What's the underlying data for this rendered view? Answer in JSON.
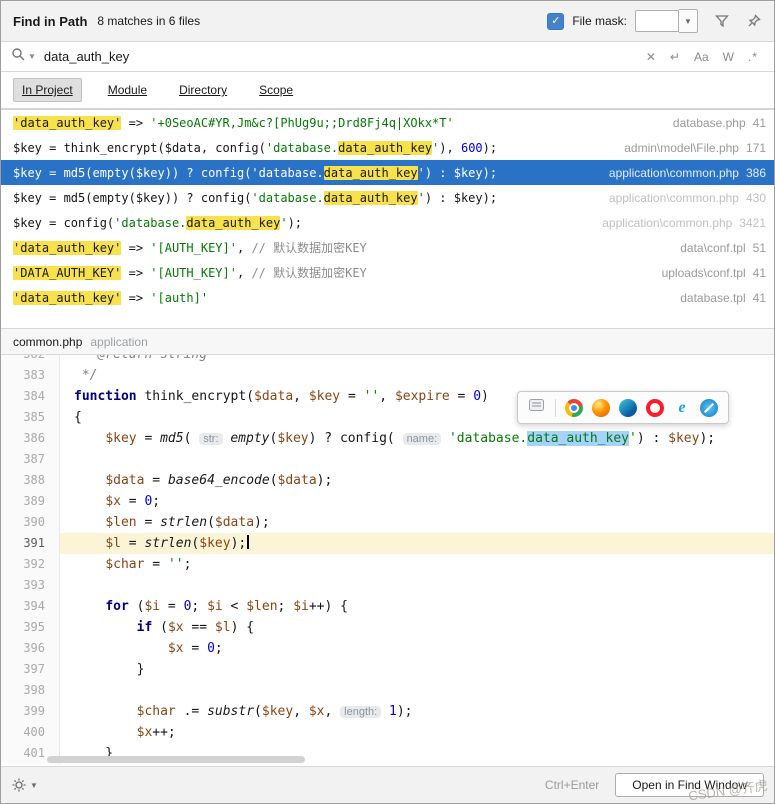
{
  "header": {
    "title": "Find in Path",
    "summary": "8 matches in 6 files",
    "file_mask_label": "File mask:",
    "file_mask_checked": true,
    "file_mask_value": ""
  },
  "search": {
    "query": "data_auth_key",
    "match_case_label": "Aa",
    "whole_words_label": "W",
    "regex_label": ".*"
  },
  "tabs": [
    {
      "label": "In Project",
      "active": true
    },
    {
      "label": "Module",
      "active": false
    },
    {
      "label": "Directory",
      "active": false
    },
    {
      "label": "Scope",
      "active": false
    }
  ],
  "results": [
    {
      "selected": false,
      "dim": false,
      "path": "database.php",
      "line": "41",
      "segments": [
        {
          "t": "'data_auth_key'",
          "c": "str match"
        },
        {
          "t": " => ",
          "c": "pl"
        },
        {
          "t": "'+0SeoAC#YR,Jm&c?[PhUg9u;;Drd8Fj4q|XOkx*T'",
          "c": "str"
        }
      ]
    },
    {
      "selected": false,
      "dim": false,
      "path": "admin\\model\\File.php",
      "line": "171",
      "segments": [
        {
          "t": "$key = think_encrypt($data, config(",
          "c": "pl"
        },
        {
          "t": "'database.",
          "c": "str"
        },
        {
          "t": "data_auth_key",
          "c": "str match"
        },
        {
          "t": "'",
          "c": "str"
        },
        {
          "t": "), ",
          "c": "pl"
        },
        {
          "t": "600",
          "c": "num"
        },
        {
          "t": ");",
          "c": "pl"
        }
      ]
    },
    {
      "selected": true,
      "dim": false,
      "path": "application\\common.php",
      "line": "386",
      "segments": [
        {
          "t": "$key = md5(empty($key)) ? config('database.",
          "c": "pl"
        },
        {
          "t": "data_auth_key",
          "c": "match"
        },
        {
          "t": "') : $key);",
          "c": "pl"
        }
      ]
    },
    {
      "selected": false,
      "dim": true,
      "path": "application\\common.php",
      "line": "430",
      "segments": [
        {
          "t": "$key = md5(empty($key)) ? config(",
          "c": "pl"
        },
        {
          "t": "'database.",
          "c": "str"
        },
        {
          "t": "data_auth_key",
          "c": "str match"
        },
        {
          "t": "'",
          "c": "str"
        },
        {
          "t": ") : $key);",
          "c": "pl"
        }
      ]
    },
    {
      "selected": false,
      "dim": true,
      "path": "application\\common.php",
      "line": "3421",
      "segments": [
        {
          "t": "$key = config(",
          "c": "pl"
        },
        {
          "t": "'database.",
          "c": "str"
        },
        {
          "t": "data_auth_key",
          "c": "str match"
        },
        {
          "t": "'",
          "c": "str"
        },
        {
          "t": ");",
          "c": "pl"
        }
      ]
    },
    {
      "selected": false,
      "dim": false,
      "path": "data\\conf.tpl",
      "line": "51",
      "segments": [
        {
          "t": "'data_auth_key'",
          "c": "str match"
        },
        {
          "t": " => ",
          "c": "pl"
        },
        {
          "t": "'[AUTH_KEY]'",
          "c": "str"
        },
        {
          "t": ", ",
          "c": "pl"
        },
        {
          "t": "// 默认数据加密KEY",
          "c": "cmt"
        }
      ]
    },
    {
      "selected": false,
      "dim": false,
      "path": "uploads\\conf.tpl",
      "line": "41",
      "segments": [
        {
          "t": "'DATA_AUTH_KEY'",
          "c": "str match"
        },
        {
          "t": " => ",
          "c": "pl"
        },
        {
          "t": "'[AUTH_KEY]'",
          "c": "str"
        },
        {
          "t": ", ",
          "c": "pl"
        },
        {
          "t": "// 默认数据加密KEY",
          "c": "cmt"
        }
      ]
    },
    {
      "selected": false,
      "dim": false,
      "path": "database.tpl",
      "line": "41",
      "segments": [
        {
          "t": "'data_auth_key'",
          "c": "str match"
        },
        {
          "t": " => ",
          "c": "pl"
        },
        {
          "t": "'[auth]'",
          "c": "str"
        }
      ]
    }
  ],
  "preview": {
    "file": "common.php",
    "module": "application"
  },
  "editor": {
    "browser_icons": [
      "open-in-browser",
      "chrome",
      "firefox",
      "edge",
      "opera",
      "internet-explorer",
      "safari"
    ],
    "lines": [
      {
        "no": "382",
        "segments": [
          {
            "t": " * @return string",
            "c": "doc"
          }
        ]
      },
      {
        "no": "383",
        "segments": [
          {
            "t": " */",
            "c": "doc"
          }
        ]
      },
      {
        "no": "384",
        "segments": [
          {
            "t": "function",
            "c": "kw"
          },
          {
            "t": " think_encrypt(",
            "c": "pl"
          },
          {
            "t": "$data",
            "c": "var"
          },
          {
            "t": ", ",
            "c": "pl"
          },
          {
            "t": "$key",
            "c": "var"
          },
          {
            "t": " = ",
            "c": "pl"
          },
          {
            "t": "''",
            "c": "str"
          },
          {
            "t": ", ",
            "c": "pl"
          },
          {
            "t": "$expire",
            "c": "var"
          },
          {
            "t": " = ",
            "c": "pl"
          },
          {
            "t": "0",
            "c": "num"
          },
          {
            "t": ")",
            "c": "pl"
          }
        ]
      },
      {
        "no": "385",
        "segments": [
          {
            "t": "{",
            "c": "pl"
          }
        ]
      },
      {
        "no": "386",
        "segments": [
          {
            "t": "    ",
            "c": "pl"
          },
          {
            "t": "$key",
            "c": "var"
          },
          {
            "t": " = ",
            "c": "pl"
          },
          {
            "t": "md5",
            "c": "fn"
          },
          {
            "t": "( ",
            "c": "pl"
          },
          {
            "t": "str:",
            "c": "hint"
          },
          {
            "t": " ",
            "c": "pl"
          },
          {
            "t": "empty",
            "c": "fn"
          },
          {
            "t": "(",
            "c": "pl"
          },
          {
            "t": "$key",
            "c": "var"
          },
          {
            "t": ") ? config( ",
            "c": "pl"
          },
          {
            "t": "name:",
            "c": "hint"
          },
          {
            "t": " ",
            "c": "pl"
          },
          {
            "t": "'database.",
            "c": "str"
          },
          {
            "t": "data_auth_key",
            "c": "str esel"
          },
          {
            "t": "'",
            "c": "str"
          },
          {
            "t": ") : ",
            "c": "pl"
          },
          {
            "t": "$key",
            "c": "var"
          },
          {
            "t": ");",
            "c": "pl"
          }
        ]
      },
      {
        "no": "387",
        "segments": []
      },
      {
        "no": "388",
        "segments": [
          {
            "t": "    ",
            "c": "pl"
          },
          {
            "t": "$data",
            "c": "var"
          },
          {
            "t": " = ",
            "c": "pl"
          },
          {
            "t": "base64_encode",
            "c": "fn"
          },
          {
            "t": "(",
            "c": "pl"
          },
          {
            "t": "$data",
            "c": "var"
          },
          {
            "t": ");",
            "c": "pl"
          }
        ]
      },
      {
        "no": "389",
        "segments": [
          {
            "t": "    ",
            "c": "pl"
          },
          {
            "t": "$x",
            "c": "var"
          },
          {
            "t": " = ",
            "c": "pl"
          },
          {
            "t": "0",
            "c": "num"
          },
          {
            "t": ";",
            "c": "pl"
          }
        ]
      },
      {
        "no": "390",
        "segments": [
          {
            "t": "    ",
            "c": "pl"
          },
          {
            "t": "$len",
            "c": "var"
          },
          {
            "t": " = ",
            "c": "pl"
          },
          {
            "t": "strlen",
            "c": "fn"
          },
          {
            "t": "(",
            "c": "pl"
          },
          {
            "t": "$data",
            "c": "var"
          },
          {
            "t": ");",
            "c": "pl"
          }
        ]
      },
      {
        "no": "391",
        "current": true,
        "caret": true,
        "segments": [
          {
            "t": "    ",
            "c": "pl"
          },
          {
            "t": "$l",
            "c": "var"
          },
          {
            "t": " = ",
            "c": "pl"
          },
          {
            "t": "strlen",
            "c": "fn"
          },
          {
            "t": "(",
            "c": "pl"
          },
          {
            "t": "$key",
            "c": "var"
          },
          {
            "t": ");",
            "c": "pl"
          }
        ]
      },
      {
        "no": "392",
        "segments": [
          {
            "t": "    ",
            "c": "pl"
          },
          {
            "t": "$char",
            "c": "var"
          },
          {
            "t": " = ",
            "c": "pl"
          },
          {
            "t": "''",
            "c": "str"
          },
          {
            "t": ";",
            "c": "pl"
          }
        ]
      },
      {
        "no": "393",
        "segments": []
      },
      {
        "no": "394",
        "segments": [
          {
            "t": "    ",
            "c": "pl"
          },
          {
            "t": "for",
            "c": "kw"
          },
          {
            "t": " (",
            "c": "pl"
          },
          {
            "t": "$i",
            "c": "var"
          },
          {
            "t": " = ",
            "c": "pl"
          },
          {
            "t": "0",
            "c": "num"
          },
          {
            "t": "; ",
            "c": "pl"
          },
          {
            "t": "$i",
            "c": "var"
          },
          {
            "t": " < ",
            "c": "pl"
          },
          {
            "t": "$len",
            "c": "var"
          },
          {
            "t": "; ",
            "c": "pl"
          },
          {
            "t": "$i",
            "c": "var"
          },
          {
            "t": "++) {",
            "c": "pl"
          }
        ]
      },
      {
        "no": "395",
        "segments": [
          {
            "t": "        ",
            "c": "pl"
          },
          {
            "t": "if",
            "c": "kw"
          },
          {
            "t": " (",
            "c": "pl"
          },
          {
            "t": "$x",
            "c": "var"
          },
          {
            "t": " == ",
            "c": "pl"
          },
          {
            "t": "$l",
            "c": "var"
          },
          {
            "t": ") {",
            "c": "pl"
          }
        ]
      },
      {
        "no": "396",
        "segments": [
          {
            "t": "            ",
            "c": "pl"
          },
          {
            "t": "$x",
            "c": "var"
          },
          {
            "t": " = ",
            "c": "pl"
          },
          {
            "t": "0",
            "c": "num"
          },
          {
            "t": ";",
            "c": "pl"
          }
        ]
      },
      {
        "no": "397",
        "segments": [
          {
            "t": "        }",
            "c": "pl"
          }
        ]
      },
      {
        "no": "398",
        "segments": []
      },
      {
        "no": "399",
        "segments": [
          {
            "t": "        ",
            "c": "pl"
          },
          {
            "t": "$char",
            "c": "var"
          },
          {
            "t": " .= ",
            "c": "pl"
          },
          {
            "t": "substr",
            "c": "fn"
          },
          {
            "t": "(",
            "c": "pl"
          },
          {
            "t": "$key",
            "c": "var"
          },
          {
            "t": ", ",
            "c": "pl"
          },
          {
            "t": "$x",
            "c": "var"
          },
          {
            "t": ", ",
            "c": "pl"
          },
          {
            "t": "length:",
            "c": "hint"
          },
          {
            "t": " ",
            "c": "pl"
          },
          {
            "t": "1",
            "c": "num"
          },
          {
            "t": ");",
            "c": "pl"
          }
        ]
      },
      {
        "no": "400",
        "segments": [
          {
            "t": "        ",
            "c": "pl"
          },
          {
            "t": "$x",
            "c": "var"
          },
          {
            "t": "++;",
            "c": "pl"
          }
        ]
      },
      {
        "no": "401",
        "segments": [
          {
            "t": "    }",
            "c": "pl"
          }
        ]
      }
    ]
  },
  "footer": {
    "shortcut": "Ctrl+Enter",
    "open_button": "Open in Find Window"
  },
  "watermark": "CSDN @齐虎"
}
